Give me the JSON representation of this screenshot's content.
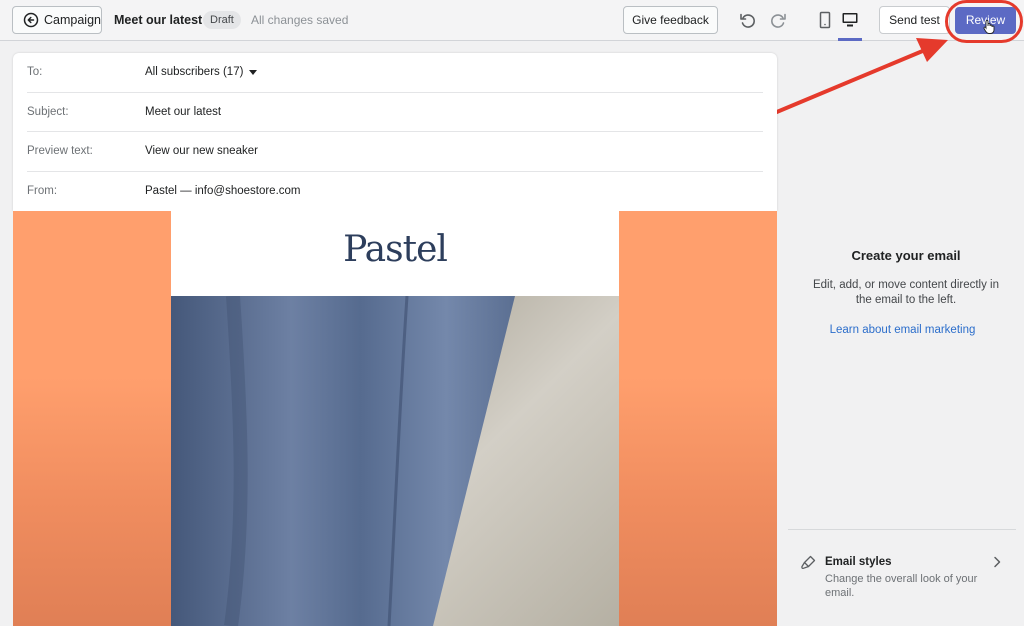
{
  "header": {
    "back_label": "Campaign",
    "campaign_title": "Meet our latest",
    "status_badge": "Draft",
    "save_status": "All changes saved",
    "feedback_label": "Give feedback",
    "send_test_label": "Send test",
    "review_label": "Review"
  },
  "email_fields": [
    {
      "label": "To:",
      "value": "All subscribers (17)"
    },
    {
      "label": "Subject:",
      "value": "Meet our latest"
    },
    {
      "label": "Preview text:",
      "value": "View our new sneaker"
    },
    {
      "label": "From:",
      "value": "Pastel — info@shoestore.com"
    }
  ],
  "email_preview": {
    "brand_name": "Pastel",
    "background_color": "#ff9f6d"
  },
  "sidebar": {
    "title": "Create your email",
    "description": "Edit, add, or move content directly in the email to the left.",
    "link_label": "Learn about email marketing",
    "styles_title": "Email styles",
    "styles_desc": "Change the overall look of your email."
  },
  "colors": {
    "accent": "#5c6ac4",
    "annotation": "#e53a2c",
    "link": "#2c6ecb"
  },
  "icons": [
    "arrow-left-circle-icon",
    "undo-icon",
    "redo-icon",
    "mobile-view-icon",
    "desktop-view-icon",
    "paintbrush-icon",
    "chevron-right-icon"
  ]
}
